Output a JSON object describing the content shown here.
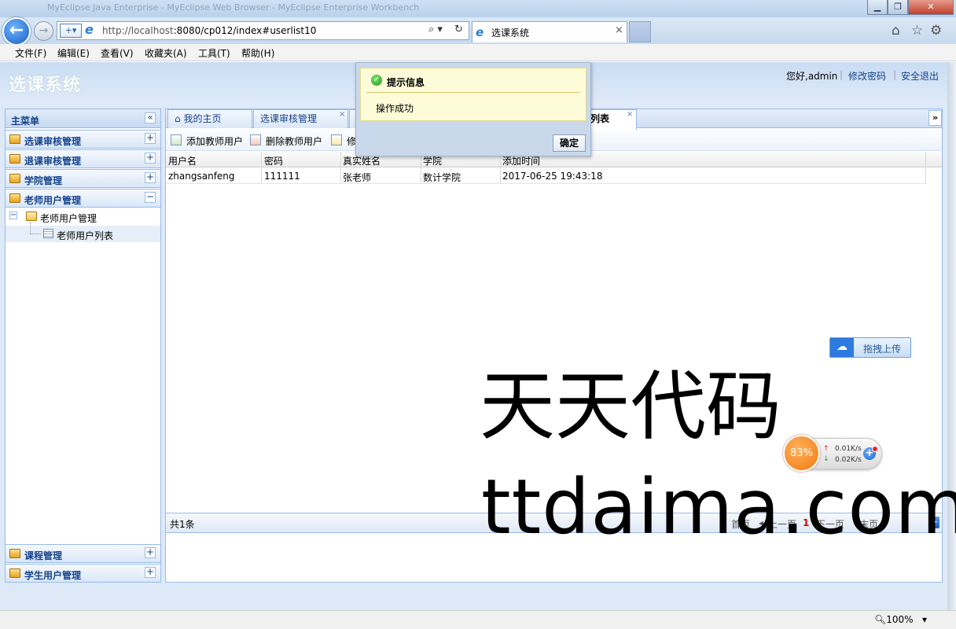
{
  "browser": {
    "window_title": "MyEclipse Java Enterprise - MyEclipse Web Browser - MyEclipse Enterprise Workbench",
    "url_host": "http://localhost",
    "url_rest": ":8080/cp012/index#userlist10",
    "tab_title": "选课系统",
    "tab_close": "×",
    "win_min": "▁",
    "win_max": "❐",
    "win_close": "✕",
    "menu": [
      "文件(F)",
      "编辑(E)",
      "查看(V)",
      "收藏夹(A)",
      "工具(T)",
      "帮助(H)"
    ],
    "zoom": "100%"
  },
  "app": {
    "title": "选课系统",
    "greeting": "您好,admin",
    "change_password": "修改密码",
    "logout": "安全退出",
    "separator": "|"
  },
  "left_menu": {
    "header": "主菜单",
    "collapse": "«",
    "items": [
      {
        "label": "选课审核管理",
        "toggle": "+"
      },
      {
        "label": "退课审核管理",
        "toggle": "+"
      },
      {
        "label": "学院管理",
        "toggle": "+"
      },
      {
        "label": "老师用户管理",
        "toggle": "−"
      }
    ],
    "tree_root": "老师用户管理",
    "tree_root_toggle": "−",
    "tree_leaf": "老师用户列表",
    "bottom_items": [
      {
        "label": "课程管理",
        "toggle": "+"
      },
      {
        "label": "学生用户管理",
        "toggle": "+"
      }
    ]
  },
  "tabs": {
    "home": "我的主页",
    "tab2": "选课审核管理",
    "tab_active_tail": "列表",
    "close": "×",
    "dropdown": "»"
  },
  "toolbar": {
    "add": "添加教师用户",
    "delete": "删除教师用户",
    "modify": "修"
  },
  "grid": {
    "columns": [
      "用户名",
      "密码",
      "真实姓名",
      "学院",
      "添加时间"
    ],
    "rows": [
      [
        "zhangsanfeng",
        "111111",
        "张老师",
        "数计学院",
        "2017-06-25 19:43:18"
      ]
    ]
  },
  "pager": {
    "total": "共1条",
    "first": "首页",
    "prev": "上一页",
    "current": "1",
    "next": "下一页",
    "last": "末页"
  },
  "dialog": {
    "title": "提示信息",
    "message": "操作成功",
    "ok": "确定"
  },
  "upload_widget": {
    "label": "拖拽上传"
  },
  "speed_widget": {
    "percent": "83%",
    "up": "0.01K/s",
    "down": "0.02K/s"
  },
  "watermark": {
    "line1": "天天代码",
    "line2": "ttdaima.com"
  }
}
